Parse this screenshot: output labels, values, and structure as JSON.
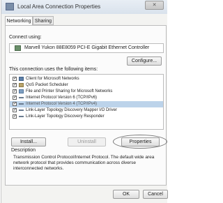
{
  "window": {
    "title": "Local Area Connection Properties",
    "close_label": "✕"
  },
  "tabs": [
    {
      "label": "Networking",
      "active": true
    },
    {
      "label": "Sharing",
      "active": false
    }
  ],
  "connect_using": {
    "label": "Connect using:",
    "adapter": "Marvell Yukon 88E8059 PCI-E Gigabit Ethernet Controller",
    "configure_label": "Configure..."
  },
  "items_section": {
    "label": "This connection uses the following items:",
    "items": [
      {
        "label": "Client for Microsoft Networks",
        "checked": true,
        "selected": false,
        "icon": "client-icon"
      },
      {
        "label": "QoS Packet Scheduler",
        "checked": true,
        "selected": false,
        "icon": "scheduler-icon"
      },
      {
        "label": "File and Printer Sharing for Microsoft Networks",
        "checked": true,
        "selected": false,
        "icon": "sharing-icon"
      },
      {
        "label": "Internet Protocol Version 6 (TCP/IPv6)",
        "checked": true,
        "selected": false,
        "icon": "protocol-icon"
      },
      {
        "label": "Internet Protocol Version 4 (TCP/IPv4)",
        "checked": true,
        "selected": true,
        "icon": "protocol-icon"
      },
      {
        "label": "Link-Layer Topology Discovery Mapper I/O Driver",
        "checked": true,
        "selected": false,
        "icon": "protocol-icon"
      },
      {
        "label": "Link-Layer Topology Discovery Responder",
        "checked": true,
        "selected": false,
        "icon": "protocol-icon"
      }
    ],
    "install_label": "Install...",
    "uninstall_label": "Uninstall",
    "properties_label": "Properties"
  },
  "description": {
    "label": "Description",
    "text": "Transmission Control Protocol/Internet Protocol. The default wide area network protocol that provides communication across diverse interconnected networks."
  },
  "footer": {
    "ok_label": "OK",
    "cancel_label": "Cancel"
  },
  "colors": {
    "selection": "#bcd3ea",
    "panel": "#fbfbfb",
    "dialog": "#f3f3f1"
  }
}
